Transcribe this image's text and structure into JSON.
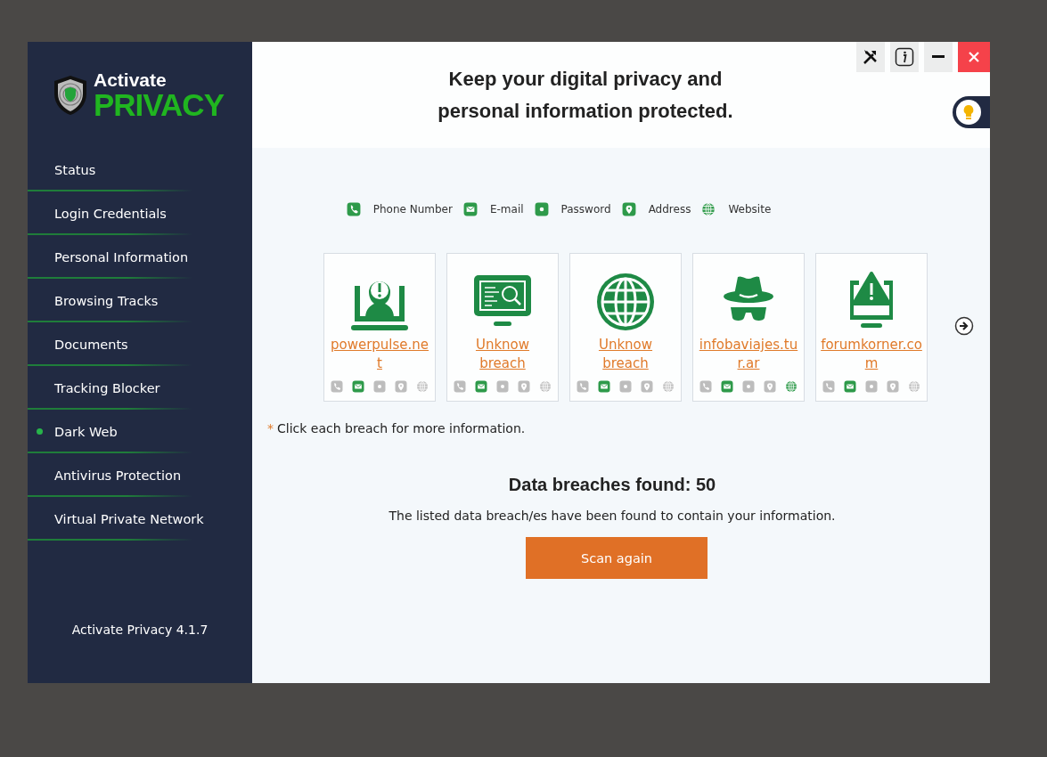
{
  "logo": {
    "top": "Activate",
    "bottom": "PRIVACY"
  },
  "sidebar": {
    "items": [
      {
        "label": "Status",
        "selected": false
      },
      {
        "label": "Login Credentials",
        "selected": false
      },
      {
        "label": "Personal Information",
        "selected": false
      },
      {
        "label": "Browsing Tracks",
        "selected": false
      },
      {
        "label": "Documents",
        "selected": false
      },
      {
        "label": "Tracking Blocker",
        "selected": false
      },
      {
        "label": "Dark Web",
        "selected": true
      },
      {
        "label": "Antivirus Protection",
        "selected": false
      },
      {
        "label": "Virtual Private Network",
        "selected": false
      }
    ],
    "version": "Activate Privacy 4.1.7"
  },
  "header": {
    "title": "Keep your digital privacy and\npersonal information protected."
  },
  "legend": [
    {
      "kind": "phone",
      "label": "Phone Number"
    },
    {
      "kind": "email",
      "label": "E-mail"
    },
    {
      "kind": "password",
      "label": "Password"
    },
    {
      "kind": "address",
      "label": "Address"
    },
    {
      "kind": "website",
      "label": "Website"
    }
  ],
  "breaches": [
    {
      "kind": "laptop-alert",
      "name": "powerpulse.net",
      "found": {
        "phone": false,
        "email": true,
        "password": false,
        "address": false,
        "website": false
      }
    },
    {
      "kind": "monitor-search",
      "name": "Unknow breach",
      "found": {
        "phone": false,
        "email": true,
        "password": false,
        "address": false,
        "website": false
      }
    },
    {
      "kind": "globe",
      "name": "Unknow breach",
      "found": {
        "phone": false,
        "email": true,
        "password": false,
        "address": false,
        "website": false
      }
    },
    {
      "kind": "spy",
      "name": "infobaviajes.tur.ar",
      "found": {
        "phone": false,
        "email": true,
        "password": false,
        "address": false,
        "website": true
      }
    },
    {
      "kind": "monitor-warning",
      "name": "forumkorner.com",
      "found": {
        "phone": false,
        "email": true,
        "password": false,
        "address": false,
        "website": false
      }
    }
  ],
  "note": {
    "mark": "*",
    "text": "Click each breach for more information."
  },
  "summary": {
    "title": "Data breaches found: 50",
    "text": "The listed data breach/es have been found to contain your information."
  },
  "scan_button": "Scan again"
}
